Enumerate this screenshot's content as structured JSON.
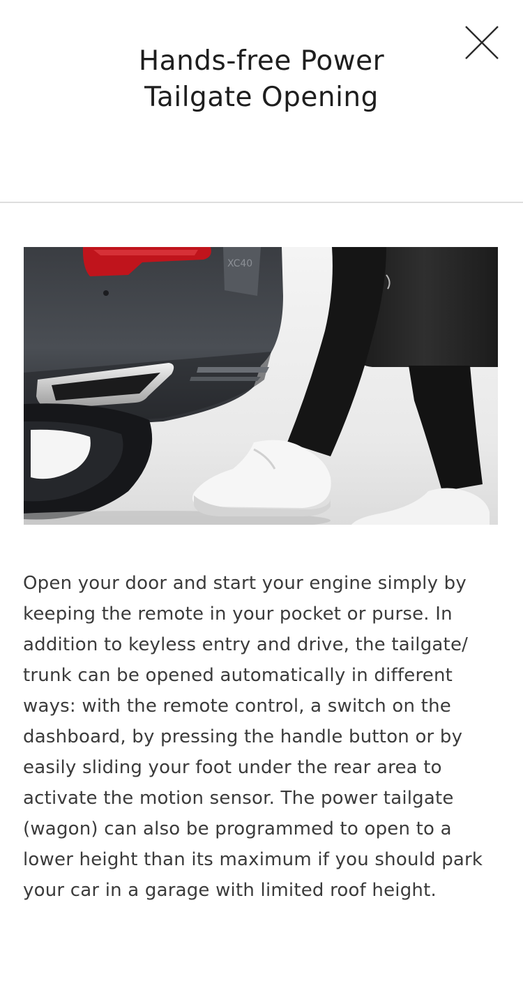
{
  "modal": {
    "title_line1": "Hands-free Power",
    "title_line2": "Tailgate Opening",
    "close_icon": "close-icon",
    "image_alt": "Person sliding foot under the rear bumper of a car to open the tailgate",
    "description": "Open your door and start your engine simply by keeping the remote in your pocket or purse. In addition to keyless entry and drive, the tailgate/ trunk can be opened automatically in different ways: with the remote control, a switch on the dashboard, by pressing the handle button or by easily sliding your foot under the rear area to activate the motion sensor. The power tailgate (wagon) can also be programmed to open to a lower height than its maximum if you should park your car in a garage with limited roof height."
  },
  "colors": {
    "background": "#ffffff",
    "divider": "#dedede",
    "title_text": "#1e1e1e",
    "body_text": "#3b3b3b",
    "tail_light": "#c0141c"
  }
}
